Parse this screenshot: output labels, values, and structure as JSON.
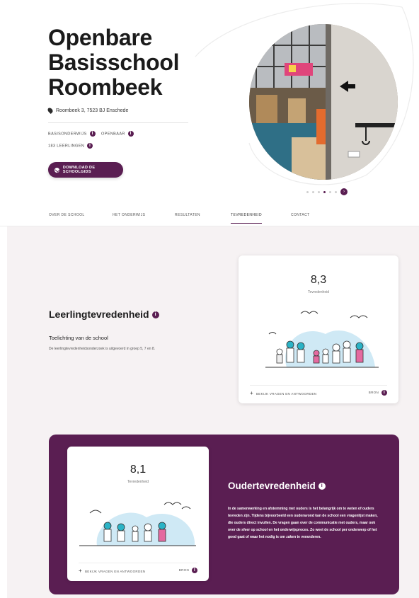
{
  "school": {
    "name": "Openbare Basisschool Roombeek",
    "address": "Roombeek 3, 7523 BJ Enschede"
  },
  "meta": {
    "denomination": "Basisonderwijs",
    "type": "Openbaar",
    "students": "183 leerlingen"
  },
  "download_label": "Download de schoolgids",
  "carousel": {
    "dot_count": 6,
    "active_index": 3,
    "next_symbol": "›"
  },
  "tabs": [
    {
      "label": "Over de school",
      "active": false
    },
    {
      "label": "Het onderwijs",
      "active": false
    },
    {
      "label": "Resultaten",
      "active": false
    },
    {
      "label": "Tevredenheid",
      "active": true
    },
    {
      "label": "Contact",
      "active": false
    }
  ],
  "student_satisfaction": {
    "score": "8,3",
    "score_label": "Tevredenheid",
    "title": "Leerlingtevredenheid",
    "subtitle": "Toelichting van de school",
    "description": "De leerlingtevredenheidsonderzoek is uitgevoerd in groep 5, 7 en 8.",
    "questions_link": "Bekijk vragen en antwoorden",
    "source_label": "Bron"
  },
  "parent_satisfaction": {
    "score": "8,1",
    "score_label": "Tevredenheid",
    "title": "Oudertevredenheid",
    "description": "In de samenwerking en afstemming met ouders is het belangrijk om te weten of ouders tevreden zijn. Tijdens bijvoorbeeld een ouderavond kan de school een vragenlijst maken, die ouders direct invullen. De vragen gaan over de communicatie met ouders, maar ook over de sfeer op school en het onderwijsproces. Zo weet de school per onderwerp of het goed gaat of waar het nodig is om zaken te veranderen.",
    "questions_link": "Bekijk vragen en antwoorden",
    "source_label": "Bron"
  },
  "icons": {
    "info": "i",
    "plus": "+"
  },
  "colors": {
    "accent": "#5a1e52",
    "section_bg": "#f6f2f3",
    "illustration_blue": "#cfe9f5",
    "figure_teal": "#2bb3c6",
    "figure_pink": "#e46aa0"
  }
}
